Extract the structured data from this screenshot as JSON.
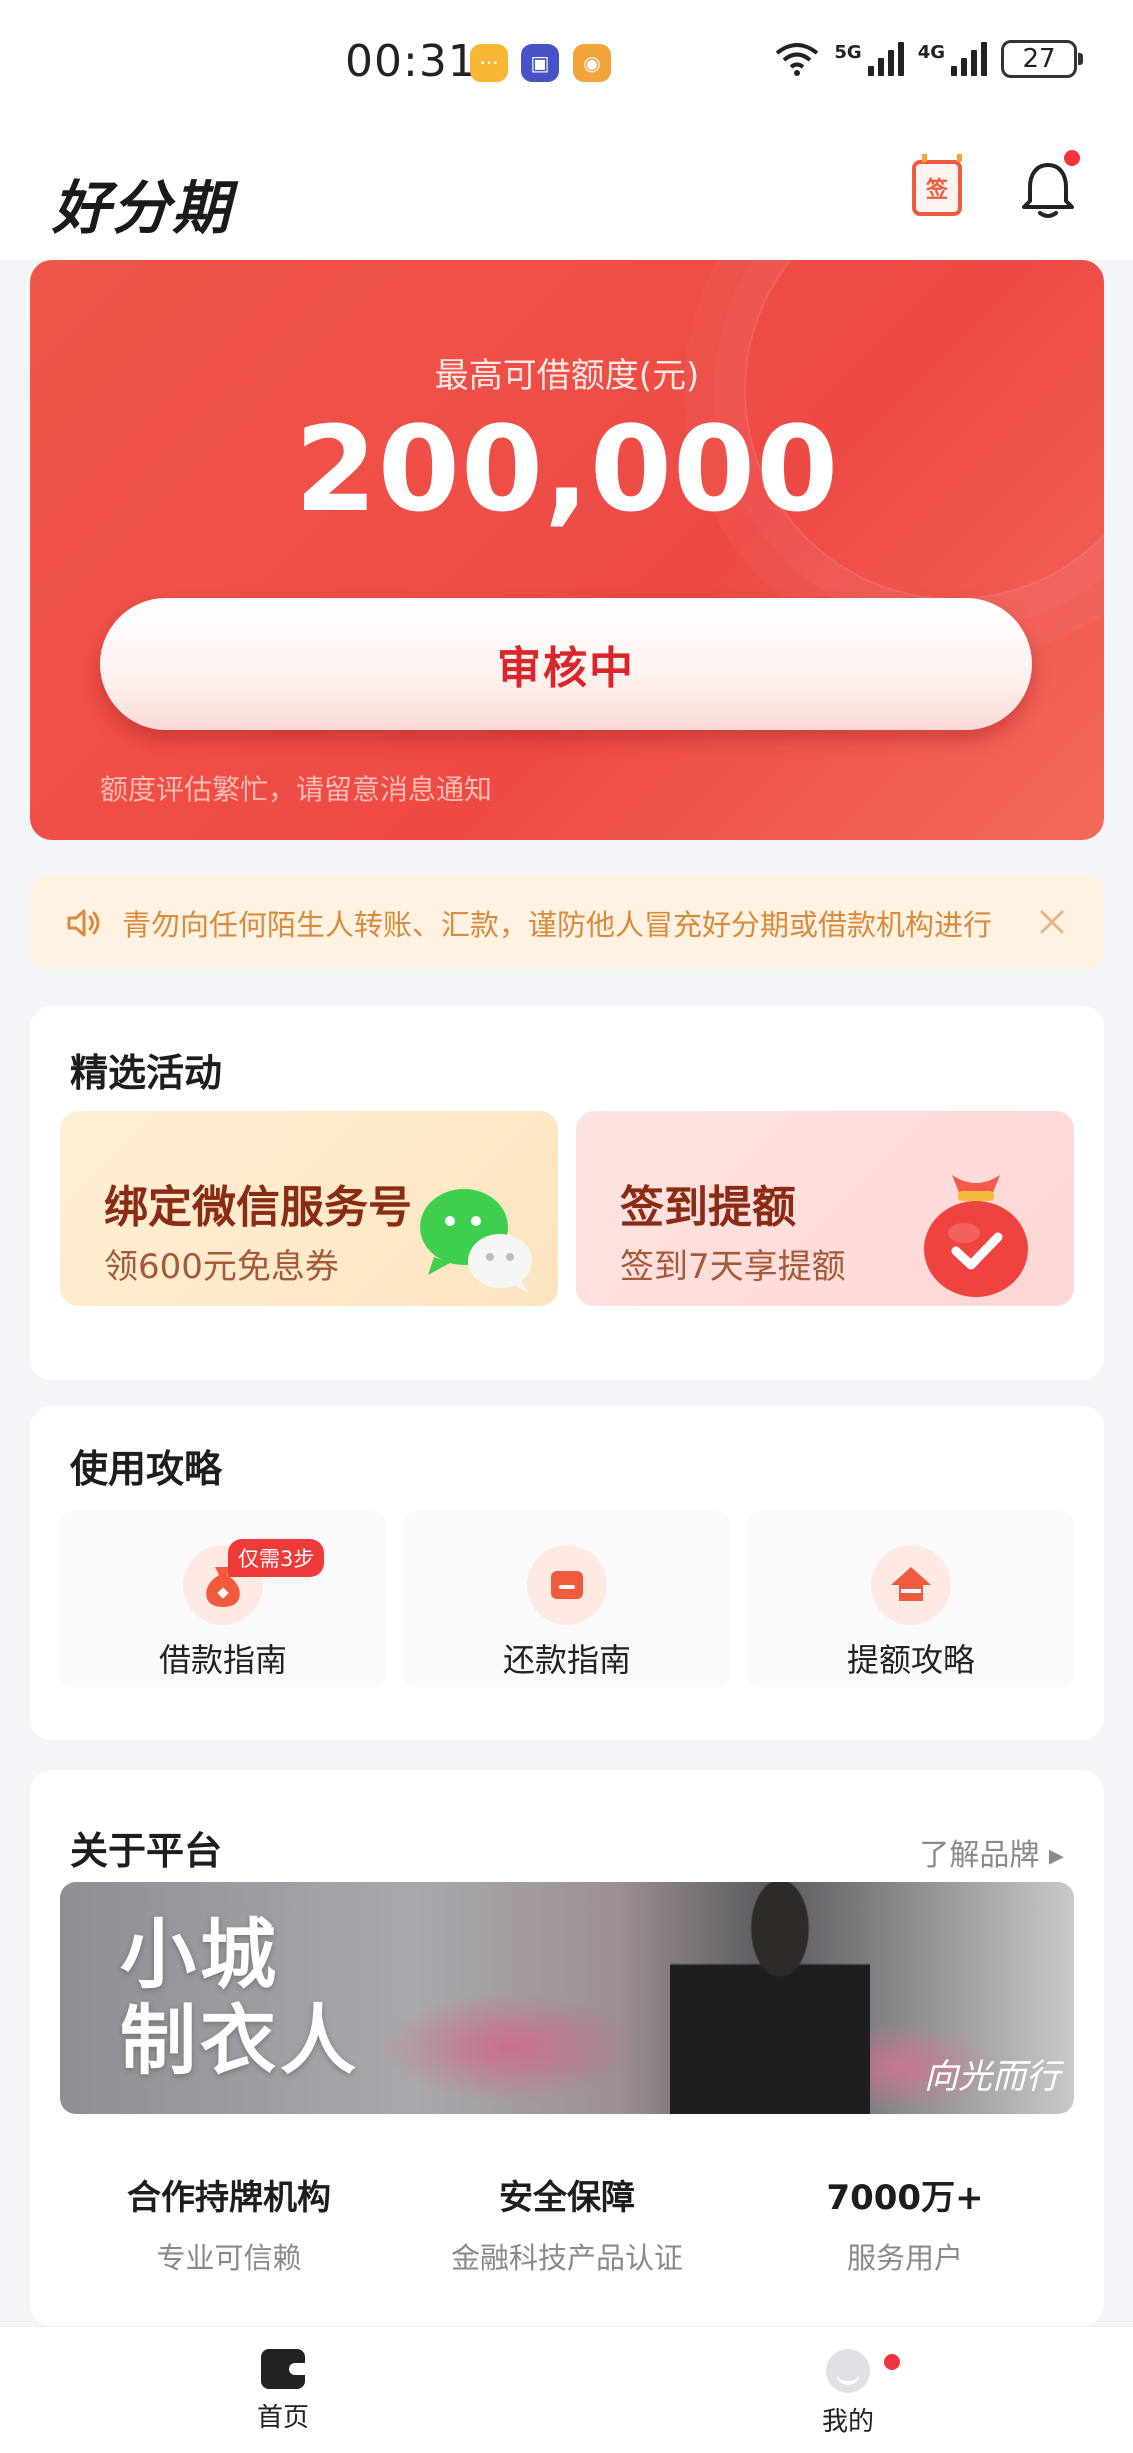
{
  "status_bar": {
    "time": "00:31",
    "network_1": "5G",
    "network_2": "4G",
    "battery": "27"
  },
  "header": {
    "logo": "好分期",
    "sign_label": "签"
  },
  "hero": {
    "label": "最高可借额度(元)",
    "amount": "200,000",
    "button": "审核中",
    "tip": "额度评估繁忙，请留意消息通知"
  },
  "notice": {
    "text": "青勿向任何陌生人转账、汇款，谨防他人冒充好分期或借款机构进行"
  },
  "activities": {
    "title": "精选活动",
    "items": [
      {
        "title": "绑定微信服务号",
        "subtitle": "领600元免息券"
      },
      {
        "title": "签到提额",
        "subtitle": "签到7天享提额"
      }
    ]
  },
  "guide": {
    "title": "使用攻略",
    "items": [
      {
        "label": "借款指南",
        "badge": "仅需3步"
      },
      {
        "label": "还款指南"
      },
      {
        "label": "提额攻略"
      }
    ]
  },
  "about": {
    "title": "关于平台",
    "link": "了解品牌 ▸",
    "banner_title_1": "小城",
    "banner_title_2": "制衣人",
    "banner_sign": "向光而行",
    "stats": [
      {
        "title": "合作持牌机构",
        "subtitle": "专业可信赖"
      },
      {
        "title": "安全保障",
        "subtitle": "金融科技产品认证"
      },
      {
        "title": "7000万+",
        "subtitle": "服务用户"
      }
    ]
  },
  "bottom_nav": {
    "home": "首页",
    "me": "我的"
  },
  "colors": {
    "brand_red": "#ee4a45",
    "button_text": "#d8262a",
    "notice_text": "#d98a3a"
  }
}
